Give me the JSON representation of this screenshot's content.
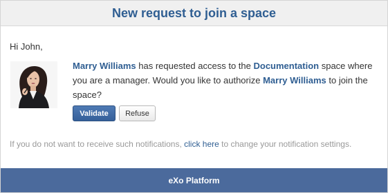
{
  "header": {
    "title": "New request to join a space"
  },
  "greeting": "Hi John,",
  "message": {
    "requester": "Marry Williams",
    "part1": " has requested access to the ",
    "space": "Documentation",
    "part2": " space where you are a manager. Would you like to authorize ",
    "requester_again": "Marry Williams",
    "part3": " to join the space?"
  },
  "actions": {
    "validate_label": "Validate",
    "refuse_label": "Refuse"
  },
  "notification_note": {
    "before": "If you do not want to receive such notifications, ",
    "link": "click here",
    "after": " to change your notification settings."
  },
  "footer": {
    "brand": "eXo Platform"
  },
  "colors": {
    "accent": "#2f5e92",
    "footer_bg": "#4b6a9c",
    "button_primary": "#3d679f"
  }
}
